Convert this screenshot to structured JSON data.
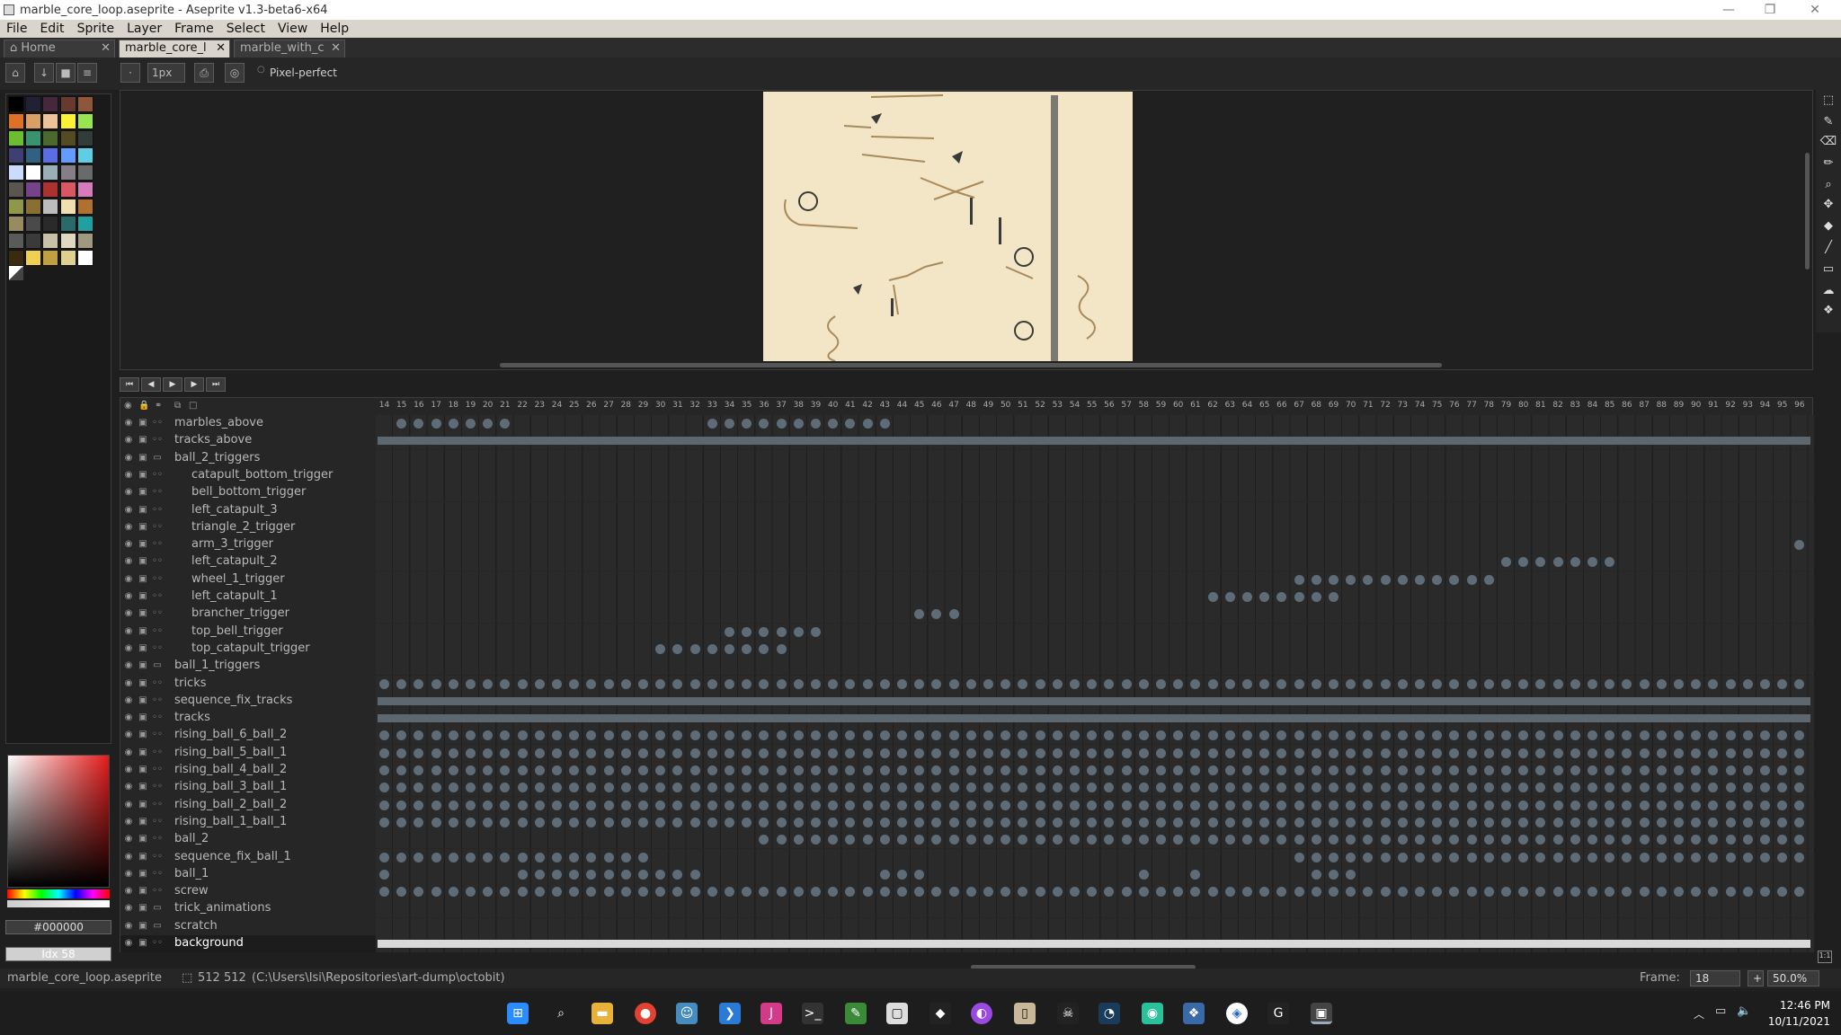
{
  "window": {
    "title": "marble_core_loop.aseprite - Aseprite v1.3-beta6-x64",
    "minimize": "—",
    "maximize": "❐",
    "close": "✕"
  },
  "menu": [
    "File",
    "Edit",
    "Sprite",
    "Layer",
    "Frame",
    "Select",
    "View",
    "Help"
  ],
  "tabs": [
    {
      "label": "⌂ Home",
      "active": false
    },
    {
      "label": "marble_core_l",
      "active": true
    },
    {
      "label": "marble_with_c",
      "active": false
    }
  ],
  "toolbar": {
    "brush_size": "1px",
    "pixel_perfect_label": "Pixel-perfect"
  },
  "palette": [
    "#000000",
    "#222034",
    "#45283c",
    "#663931",
    "#8f563b",
    "#df7126",
    "#d9a066",
    "#eec39a",
    "#fbf236",
    "#99e550",
    "#6abe30",
    "#37946e",
    "#4b692f",
    "#524b24",
    "#323c39",
    "#3f3f74",
    "#306082",
    "#5b6ee1",
    "#639bff",
    "#5fcde4",
    "#cbdbfc",
    "#ffffff",
    "#9badb7",
    "#847e87",
    "#696a6a",
    "#595652",
    "#76428a",
    "#ac3232",
    "#d95763",
    "#d77bba",
    "#8f974a",
    "#8a6f30",
    "#bcbcbc",
    "#f0e0b0",
    "#b07030",
    "#9a8a60",
    "#4a4a4a",
    "#2a2a2a",
    "#2a6a6a",
    "#20a0a0",
    "#5a5a5a",
    "#3a3a3a",
    "#c8c0a8",
    "#e0d8c0",
    "#a09880",
    "#3a2a10",
    "#f0d050",
    "#c0a040",
    "#e0d090",
    "#ffffff"
  ],
  "color_fields": {
    "foreground": "#000000",
    "background": "Idx 58"
  },
  "timeline": {
    "frame_numbers": [
      14,
      15,
      16,
      17,
      18,
      19,
      20,
      21,
      22,
      23,
      24,
      25,
      26,
      27,
      28,
      29,
      30,
      31,
      32,
      33,
      34,
      35,
      36,
      37,
      38,
      39,
      40,
      41,
      42,
      43,
      44,
      45,
      46,
      47,
      48,
      49,
      50,
      51,
      52,
      53,
      54,
      55,
      56,
      57,
      58,
      59,
      60,
      61,
      62,
      63,
      64,
      65,
      66,
      67,
      68,
      69,
      70,
      71,
      72,
      73,
      74,
      75,
      76,
      77,
      78,
      79,
      80,
      81,
      82,
      83,
      84,
      85,
      86,
      87,
      88,
      89,
      90,
      91,
      92,
      93,
      94,
      95,
      96
    ],
    "layers": [
      {
        "name": "marbles_above",
        "type": "layer",
        "indent": 0,
        "cels": [
          1,
          2,
          3,
          4,
          5,
          6,
          7,
          19,
          20,
          21,
          22,
          23,
          24,
          25,
          26,
          27,
          28,
          29
        ]
      },
      {
        "name": "tracks_above",
        "type": "layer",
        "indent": 0,
        "bar": true
      },
      {
        "name": "ball_2_triggers",
        "type": "group",
        "indent": 0,
        "cels": []
      },
      {
        "name": "catapult_bottom_trigger",
        "type": "layer",
        "indent": 1,
        "cels": []
      },
      {
        "name": "bell_bottom_trigger",
        "type": "layer",
        "indent": 1,
        "cels": []
      },
      {
        "name": "left_catapult_3",
        "type": "layer",
        "indent": 1,
        "cels": []
      },
      {
        "name": "triangle_2_trigger",
        "type": "layer",
        "indent": 1,
        "cels": []
      },
      {
        "name": "arm_3_trigger",
        "type": "layer",
        "indent": 1,
        "cels": [
          82
        ]
      },
      {
        "name": "left_catapult_2",
        "type": "layer",
        "indent": 1,
        "cels": [
          65,
          66,
          67,
          68,
          69,
          70,
          71
        ]
      },
      {
        "name": "wheel_1_trigger",
        "type": "layer",
        "indent": 1,
        "cels": [
          53,
          54,
          55,
          56,
          57,
          58,
          59,
          60,
          61,
          62,
          63,
          64
        ]
      },
      {
        "name": "left_catapult_1",
        "type": "layer",
        "indent": 1,
        "cels": [
          48,
          49,
          50,
          51,
          52,
          53,
          54,
          55
        ]
      },
      {
        "name": "brancher_trigger",
        "type": "layer",
        "indent": 1,
        "cels": [
          31,
          32,
          33
        ]
      },
      {
        "name": "top_bell_trigger",
        "type": "layer",
        "indent": 1,
        "cels": [
          20,
          21,
          22,
          23,
          24,
          25
        ]
      },
      {
        "name": "top_catapult_trigger",
        "type": "layer",
        "indent": 1,
        "cels": [
          16,
          17,
          18,
          19,
          20,
          21,
          22,
          23
        ]
      },
      {
        "name": "ball_1_triggers",
        "type": "group",
        "indent": 0,
        "cels": []
      },
      {
        "name": "tricks",
        "type": "layer",
        "indent": 0,
        "all": true
      },
      {
        "name": "sequence_fix_tracks",
        "type": "layer",
        "indent": 0,
        "bar": true
      },
      {
        "name": "tracks",
        "type": "layer",
        "indent": 0,
        "bar": true
      },
      {
        "name": "rising_ball_6_ball_2",
        "type": "layer",
        "indent": 0,
        "all": true
      },
      {
        "name": "rising_ball_5_ball_1",
        "type": "layer",
        "indent": 0,
        "all": true
      },
      {
        "name": "rising_ball_4_ball_2",
        "type": "layer",
        "indent": 0,
        "all": true
      },
      {
        "name": "rising_ball_3_ball_1",
        "type": "layer",
        "indent": 0,
        "all": true
      },
      {
        "name": "rising_ball_2_ball_2",
        "type": "layer",
        "indent": 0,
        "all": true
      },
      {
        "name": "rising_ball_1_ball_1",
        "type": "layer",
        "indent": 0,
        "all": true
      },
      {
        "name": "ball_2",
        "type": "layer",
        "indent": 0,
        "range": [
          22,
          82
        ]
      },
      {
        "name": "sequence_fix_ball_1",
        "type": "layer",
        "indent": 0,
        "cels": [
          0,
          1,
          2,
          3,
          4,
          5,
          6,
          7,
          8,
          9,
          10,
          11,
          12,
          13,
          14,
          15,
          53,
          54,
          55,
          56,
          57,
          58,
          59,
          60,
          61,
          62,
          63,
          64,
          65,
          66,
          67,
          68,
          69,
          70,
          71,
          72,
          73,
          74,
          75,
          76,
          77,
          78,
          79,
          80,
          81,
          82
        ]
      },
      {
        "name": "ball_1",
        "type": "layer",
        "indent": 0,
        "cels": [
          0,
          8,
          9,
          10,
          11,
          12,
          13,
          14,
          15,
          16,
          17,
          18,
          29,
          30,
          31,
          44,
          47,
          54,
          55,
          56
        ]
      },
      {
        "name": "screw",
        "type": "layer",
        "indent": 0,
        "all": true
      },
      {
        "name": "trick_animations",
        "type": "group",
        "indent": 0,
        "cels": []
      },
      {
        "name": "scratch",
        "type": "group",
        "indent": 0,
        "cels": []
      },
      {
        "name": "background",
        "type": "layer",
        "indent": 0,
        "bar": true,
        "light": true,
        "selected": true
      }
    ]
  },
  "status": {
    "filename": "marble_core_loop.aseprite",
    "size": "512 512",
    "path": "(C:\\Users\\Isi\\Repositories\\art-dump\\octobit)",
    "frame_label": "Frame:",
    "frame_value": "18",
    "zoom": "50.0%"
  },
  "taskbar": {
    "time": "12:46 PM",
    "date": "10/11/2021"
  }
}
